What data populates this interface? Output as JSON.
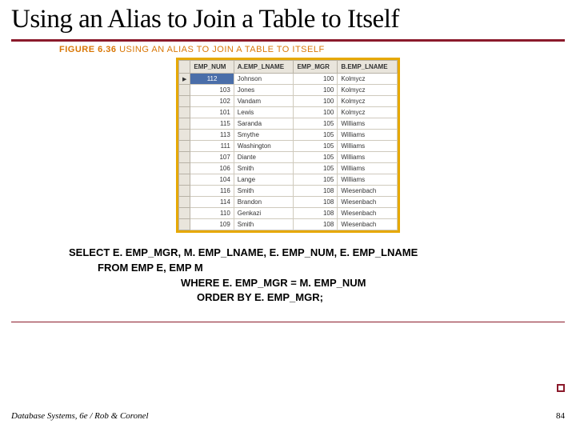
{
  "title": "Using an Alias to Join a Table to Itself",
  "figure": {
    "number": "FIGURE 6.36",
    "caption": "USING AN ALIAS TO JOIN A TABLE TO ITSELF"
  },
  "table": {
    "columns": [
      "EMP_NUM",
      "A.EMP_LNAME",
      "EMP_MGR",
      "B.EMP_LNAME"
    ],
    "selected_row_index": 0,
    "rows": [
      {
        "emp_num": "112",
        "a_lname": "Johnson",
        "emp_mgr": "100",
        "b_lname": "Kolmycz"
      },
      {
        "emp_num": "103",
        "a_lname": "Jones",
        "emp_mgr": "100",
        "b_lname": "Kolmycz"
      },
      {
        "emp_num": "102",
        "a_lname": "Vandam",
        "emp_mgr": "100",
        "b_lname": "Kolmycz"
      },
      {
        "emp_num": "101",
        "a_lname": "Lewis",
        "emp_mgr": "100",
        "b_lname": "Kolmycz"
      },
      {
        "emp_num": "115",
        "a_lname": "Saranda",
        "emp_mgr": "105",
        "b_lname": "Williams"
      },
      {
        "emp_num": "113",
        "a_lname": "Smythe",
        "emp_mgr": "105",
        "b_lname": "Williams"
      },
      {
        "emp_num": "111",
        "a_lname": "Washington",
        "emp_mgr": "105",
        "b_lname": "Williams"
      },
      {
        "emp_num": "107",
        "a_lname": "Diante",
        "emp_mgr": "105",
        "b_lname": "Williams"
      },
      {
        "emp_num": "106",
        "a_lname": "Smith",
        "emp_mgr": "105",
        "b_lname": "Williams"
      },
      {
        "emp_num": "104",
        "a_lname": "Lange",
        "emp_mgr": "105",
        "b_lname": "Williams"
      },
      {
        "emp_num": "116",
        "a_lname": "Smith",
        "emp_mgr": "108",
        "b_lname": "Wiesenbach"
      },
      {
        "emp_num": "114",
        "a_lname": "Brandon",
        "emp_mgr": "108",
        "b_lname": "Wiesenbach"
      },
      {
        "emp_num": "110",
        "a_lname": "Genkazi",
        "emp_mgr": "108",
        "b_lname": "Wiesenbach"
      },
      {
        "emp_num": "109",
        "a_lname": "Smith",
        "emp_mgr": "108",
        "b_lname": "Wiesenbach"
      }
    ]
  },
  "sql": {
    "line1": "SELECT E. EMP_MGR, M. EMP_LNAME, E. EMP_NUM, E. EMP_LNAME",
    "line2": "FROM EMP E, EMP M",
    "line3": "WHERE E. EMP_MGR = M. EMP_NUM",
    "line4": "ORDER BY E. EMP_MGR;"
  },
  "footer": {
    "left": "Database Systems, 6e / Rob & Coronel",
    "right": "84"
  }
}
